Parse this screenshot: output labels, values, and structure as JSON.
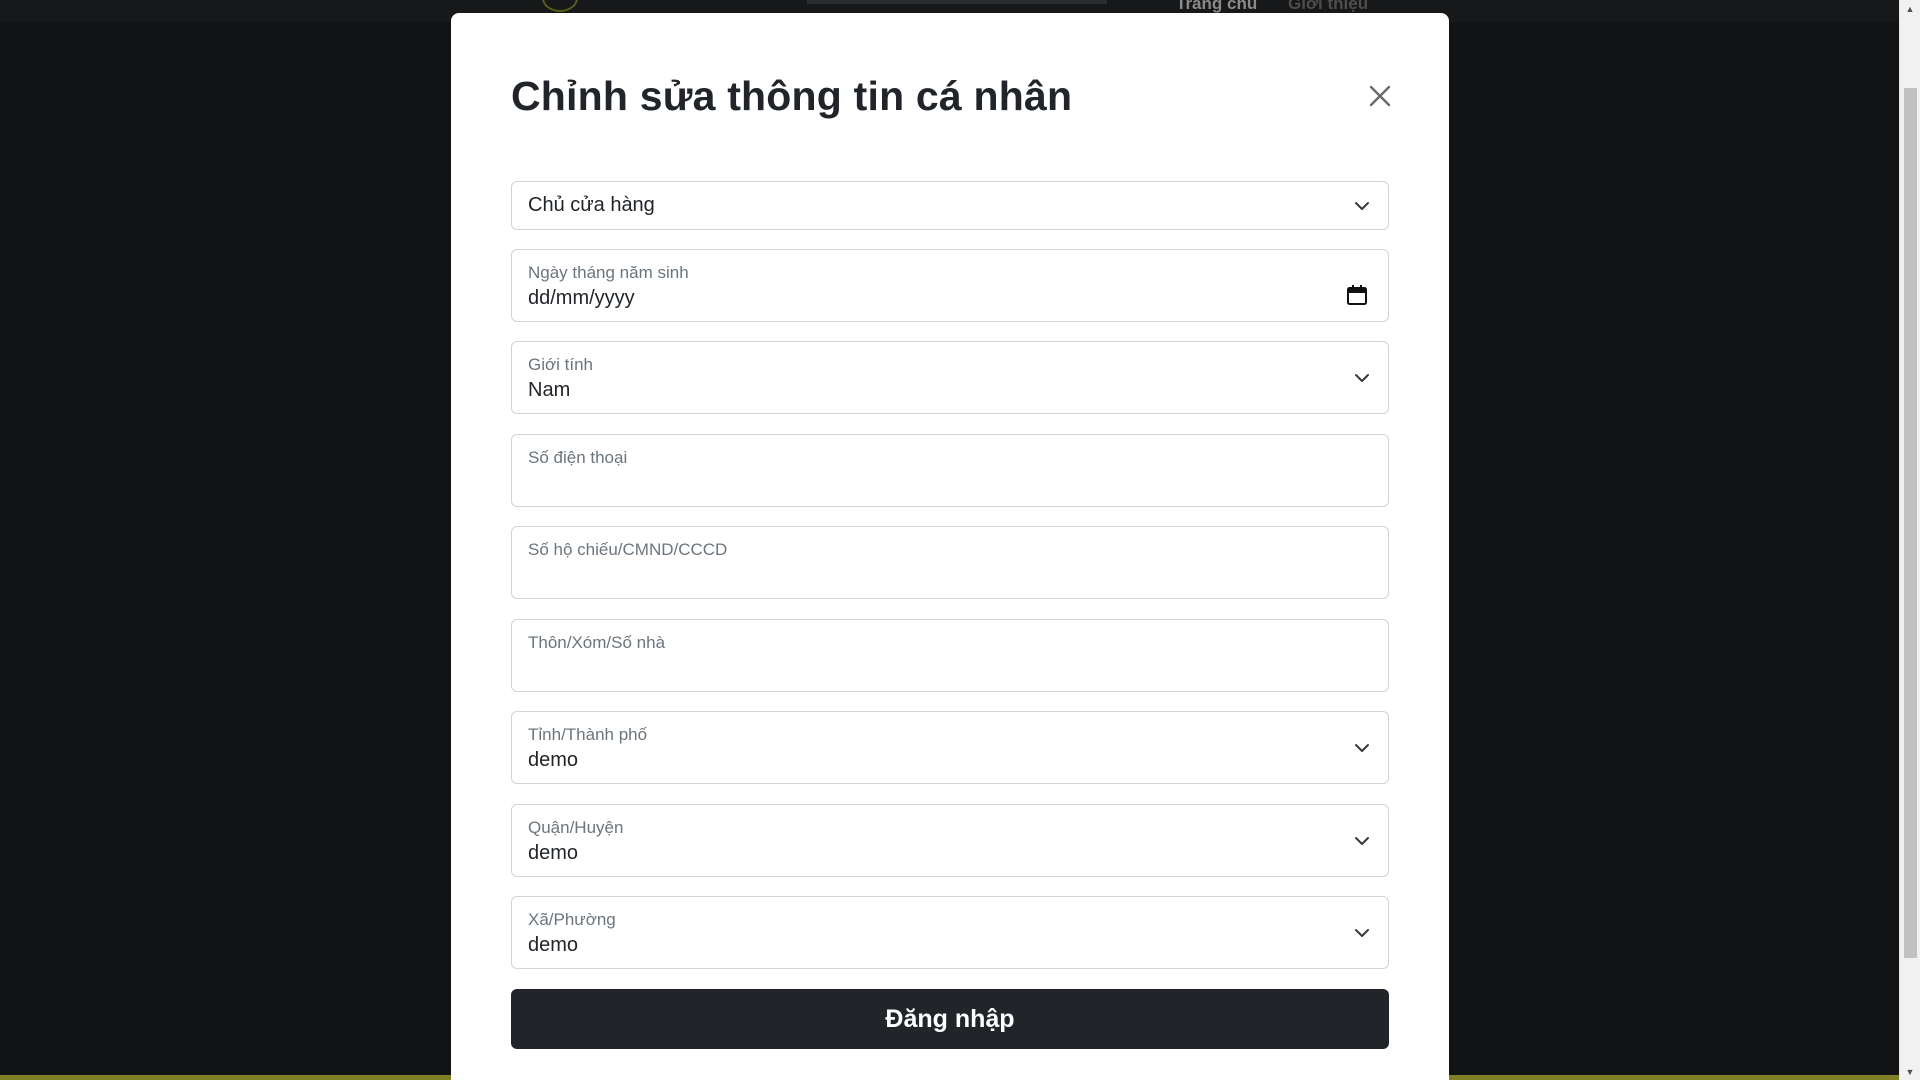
{
  "background": {
    "nav_links": [
      "Trang chủ",
      "Giới thiệu"
    ]
  },
  "modal": {
    "title": "Chỉnh sửa thông tin cá nhân",
    "close_icon": "close-icon",
    "role_select": {
      "value": "Chủ cửa hàng",
      "icon": "chevron-down-icon"
    },
    "birthdate": {
      "label": "Ngày tháng năm sinh",
      "placeholder": "dd/mm/yyyy",
      "icon": "calendar-icon"
    },
    "gender": {
      "label": "Giới tính",
      "value": "Nam",
      "icon": "chevron-down-icon"
    },
    "phone": {
      "label": "Số điện thoại",
      "value": ""
    },
    "id_number": {
      "label": "Số hộ chiếu/CMND/CCCD",
      "value": ""
    },
    "address": {
      "label": "Thôn/Xóm/Số nhà",
      "value": ""
    },
    "province": {
      "label": "Tỉnh/Thành phố",
      "value": "demo",
      "icon": "chevron-down-icon"
    },
    "district": {
      "label": "Quận/Huyện",
      "value": "demo",
      "icon": "chevron-down-icon"
    },
    "ward": {
      "label": "Xã/Phường",
      "value": "demo",
      "icon": "chevron-down-icon"
    },
    "submit_label": "Đăng nhập"
  },
  "colors": {
    "backdrop": "#121315",
    "modal_bg": "#ffffff",
    "button_bg": "#212529",
    "border": "#ced4da",
    "label": "#6c757d",
    "accent_footer": "#7f7f26"
  }
}
